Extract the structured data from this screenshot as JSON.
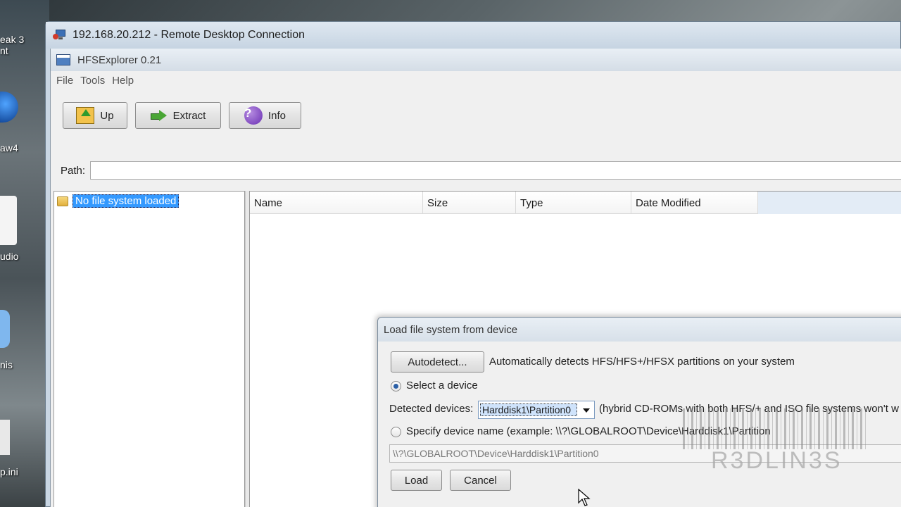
{
  "desktop": {
    "icons": [
      "eak 3\nnt",
      "aw4",
      "udio",
      "nis",
      "p.ini"
    ]
  },
  "rdc": {
    "title": "192.168.20.212 - Remote Desktop Connection"
  },
  "hfs": {
    "title": "HFSExplorer 0.21",
    "menu": [
      "File",
      "Tools",
      "Help"
    ],
    "toolbar": {
      "up_label": "Up",
      "extract_label": "Extract",
      "info_label": "Info"
    },
    "path_label": "Path:",
    "path_value": "",
    "tree_item": "No file system loaded",
    "columns": [
      "Name",
      "Size",
      "Type",
      "Date Modified"
    ]
  },
  "dialog": {
    "title": "Load file system from device",
    "autodetect_label": "Autodetect...",
    "autodetect_desc": "Automatically detects HFS/HFS+/HFSX partitions on your system",
    "select_device_label": "Select a device",
    "detected_devices_label": "Detected devices:",
    "detected_device_value": "Harddisk1\\Partition0",
    "hybrid_note": "(hybrid CD-ROMs with both HFS/+ and ISO file systems won't w",
    "specify_label": "Specify device name (example: \\\\?\\GLOBALROOT\\Device\\Harddisk1\\Partition",
    "device_name_value": "\\\\?\\GLOBALROOT\\Device\\Harddisk1\\Partition0",
    "load_label": "Load",
    "cancel_label": "Cancel"
  },
  "watermark": "R3DLIN3S"
}
